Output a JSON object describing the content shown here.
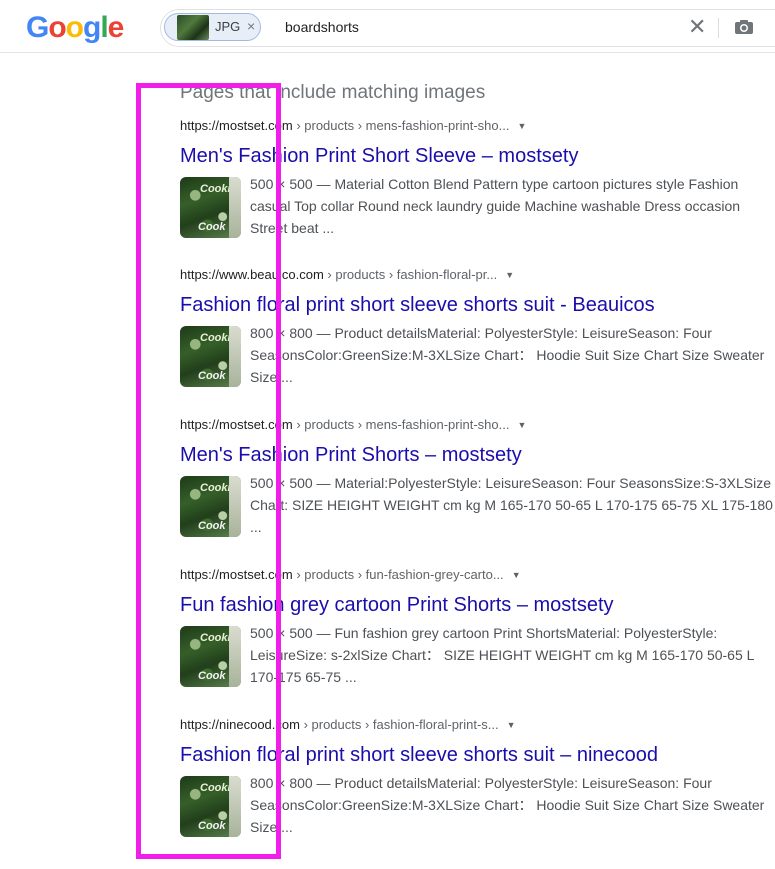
{
  "header": {
    "logo_letters": [
      {
        "char": "G",
        "color": "#4285f4"
      },
      {
        "char": "o",
        "color": "#ea4335"
      },
      {
        "char": "o",
        "color": "#fbbc05"
      },
      {
        "char": "g",
        "color": "#4285f4"
      },
      {
        "char": "l",
        "color": "#34a853"
      },
      {
        "char": "e",
        "color": "#ea4335"
      }
    ],
    "image_chip_label": "JPG",
    "image_chip_close": "×",
    "query": "boardshorts",
    "clear_glyph": "✕",
    "camera_icon": "camera-icon"
  },
  "section_title": "Pages that include matching images",
  "results": [
    {
      "url_host": "https://mostset.com",
      "url_path": " › products › mens-fashion-print-sho...",
      "title": "Men's Fashion Print Short Sleeve – mostsety",
      "snippet": "500 × 500 — Material Cotton Blend Pattern type cartoon pictures style Fashion casual Top collar Round neck laundry guide Machine washable Dress occasion Street beat ..."
    },
    {
      "url_host": "https://www.beauico.com",
      "url_path": " › products › fashion-floral-pr...",
      "title": "Fashion floral print short sleeve shorts suit - Beauicos",
      "snippet": "800 × 800 — Product detailsMaterial: PolyesterStyle: LeisureSeason: Four SeasonsColor:GreenSize:M-3XLSize Chart： Hoodie Suit Size Chart Size Sweater Size ..."
    },
    {
      "url_host": "https://mostset.com",
      "url_path": " › products › mens-fashion-print-sho...",
      "title": "Men's Fashion Print Shorts – mostsety",
      "snippet": "500 × 500 — Material:PolyesterStyle: LeisureSeason: Four SeasonsSize:S-3XLSize Chart: SIZE HEIGHT WEIGHT cm kg M 165-170 50-65 L 170-175 65-75 XL 175-180 ..."
    },
    {
      "url_host": "https://mostset.com",
      "url_path": " › products › fun-fashion-grey-carto...",
      "title": "Fun fashion grey cartoon Print Shorts – mostsety",
      "snippet": "500 × 500 — Fun fashion grey cartoon Print ShortsMaterial: PolyesterStyle: LeisureSize: s-2xlSize Chart： SIZE HEIGHT WEIGHT cm kg M 165-170 50-65 L 170-175 65-75 ..."
    },
    {
      "url_host": "https://ninecood.com",
      "url_path": " › products › fashion-floral-print-s...",
      "title": "Fashion floral print short sleeve shorts suit – ninecood",
      "snippet": "800 × 800 — Product detailsMaterial: PolyesterStyle: LeisureSeason: Four SeasonsColor:GreenSize:M-3XLSize Chart： Hoodie Suit Size Chart Size Sweater Size ..."
    }
  ],
  "thumb_text": {
    "top": "Cookies",
    "bottom": "Cook"
  },
  "colors": {
    "link": "#1a0dab",
    "highlight": "#f01ee8"
  }
}
